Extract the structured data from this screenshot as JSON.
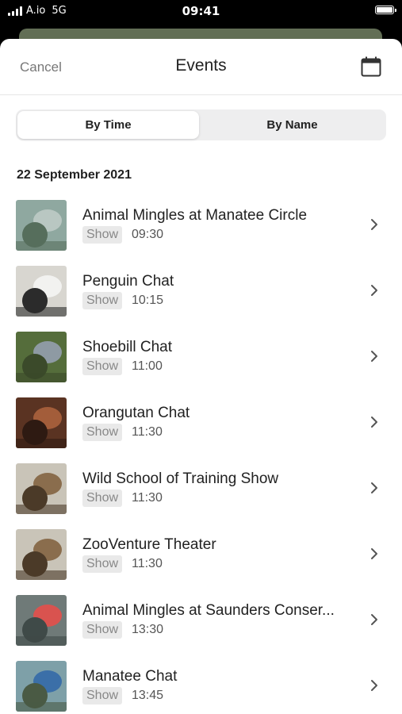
{
  "status": {
    "carrier": "A.io",
    "network": "5G",
    "time": "09:41"
  },
  "nav": {
    "cancel": "Cancel",
    "title": "Events",
    "calendar_icon": "calendar-icon"
  },
  "segment": {
    "by_time": "By Time",
    "by_name": "By Name",
    "selected": "By Time"
  },
  "date_header": "22 September 2021",
  "events": [
    {
      "title": "Animal Mingles at Manatee Circle",
      "tag": "Show",
      "time": "09:30",
      "thumb": {
        "bg": "#8fa8a0",
        "accent": "#b9c7c2",
        "dark": "#566e5c"
      }
    },
    {
      "title": "Penguin Chat",
      "tag": "Show",
      "time": "10:15",
      "thumb": {
        "bg": "#d8d6d0",
        "accent": "#f2f2f0",
        "dark": "#2b2b2b"
      }
    },
    {
      "title": "Shoebill Chat",
      "tag": "Show",
      "time": "11:00",
      "thumb": {
        "bg": "#556d3b",
        "accent": "#8e9aa3",
        "dark": "#3b4a2a"
      }
    },
    {
      "title": "Orangutan Chat",
      "tag": "Show",
      "time": "11:30",
      "thumb": {
        "bg": "#5a3322",
        "accent": "#a35d3a",
        "dark": "#2e1a12"
      }
    },
    {
      "title": "Wild School of Training Show",
      "tag": "Show",
      "time": "11:30",
      "thumb": {
        "bg": "#c9c4b8",
        "accent": "#8a6d4d",
        "dark": "#4b3a28"
      }
    },
    {
      "title": "ZooVenture Theater",
      "tag": "Show",
      "time": "11:30",
      "thumb": {
        "bg": "#c9c4b8",
        "accent": "#8a6d4d",
        "dark": "#4b3a28"
      }
    },
    {
      "title": "Animal Mingles at Saunders Conser...",
      "tag": "Show",
      "time": "13:30",
      "thumb": {
        "bg": "#6f7a78",
        "accent": "#d9534f",
        "dark": "#3f4a48"
      }
    },
    {
      "title": "Manatee Chat",
      "tag": "Show",
      "time": "13:45",
      "thumb": {
        "bg": "#7ea0a8",
        "accent": "#3b6fa8",
        "dark": "#4a5a44"
      }
    }
  ]
}
